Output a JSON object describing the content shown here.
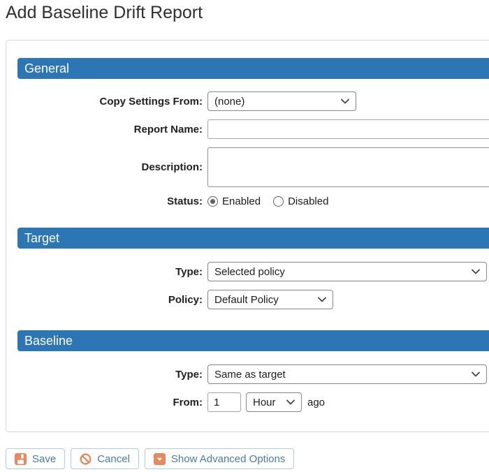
{
  "page": {
    "title": "Add Baseline Drift Report"
  },
  "sections": {
    "general": {
      "title": "General",
      "copy_settings_label": "Copy Settings From:",
      "copy_settings_value": "(none)",
      "report_name_label": "Report Name:",
      "report_name_value": "",
      "description_label": "Description:",
      "description_value": "",
      "status_label": "Status:",
      "status_options": [
        {
          "label": "Enabled",
          "selected": true
        },
        {
          "label": "Disabled",
          "selected": false
        }
      ]
    },
    "target": {
      "title": "Target",
      "type_label": "Type:",
      "type_value": "Selected policy",
      "policy_label": "Policy:",
      "policy_value": "Default Policy"
    },
    "baseline": {
      "title": "Baseline",
      "type_label": "Type:",
      "type_value": "Same as target",
      "from_label": "From:",
      "from_value": "1",
      "from_unit_value": "Hour",
      "from_suffix": "ago"
    }
  },
  "buttons": {
    "save": "Save",
    "cancel": "Cancel",
    "advanced": "Show Advanced Options"
  },
  "icons": {
    "save": "floppy-disk",
    "cancel": "ban-circle",
    "advanced": "caret-down-square",
    "select_arrow": "chevron-down"
  },
  "colors": {
    "section_header_bg": "#2d76b6",
    "section_header_text": "#ffffff",
    "button_text": "#4a7aab",
    "button_border": "#b0cce4",
    "icon_accent": "#e8885d",
    "title_text": "#2f2f2f"
  }
}
